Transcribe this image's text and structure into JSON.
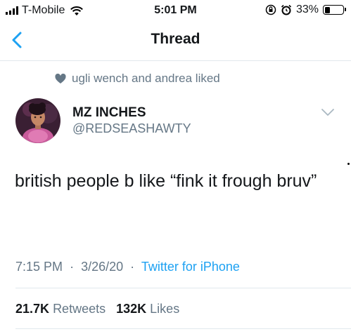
{
  "status_bar": {
    "carrier": "T-Mobile",
    "time": "5:01 PM",
    "battery_percent": "33%",
    "battery_level": 0.33
  },
  "nav": {
    "title": "Thread"
  },
  "social_context": "ugli wench and andrea liked",
  "author": {
    "name": "MZ INCHES",
    "handle": "@REDSEASHAWTY"
  },
  "tweet": {
    "text": "british people b like “fink it frough bruv”"
  },
  "meta": {
    "time": "7:15 PM",
    "date": "3/26/20",
    "separator": "·",
    "source": "Twitter for iPhone"
  },
  "stats": {
    "retweets_count": "21.7K",
    "retweets_label": "Retweets",
    "likes_count": "132K",
    "likes_label": "Likes"
  },
  "colors": {
    "accent": "#1da1f2",
    "secondary_text": "#657786",
    "divider": "#e1e8ed"
  }
}
